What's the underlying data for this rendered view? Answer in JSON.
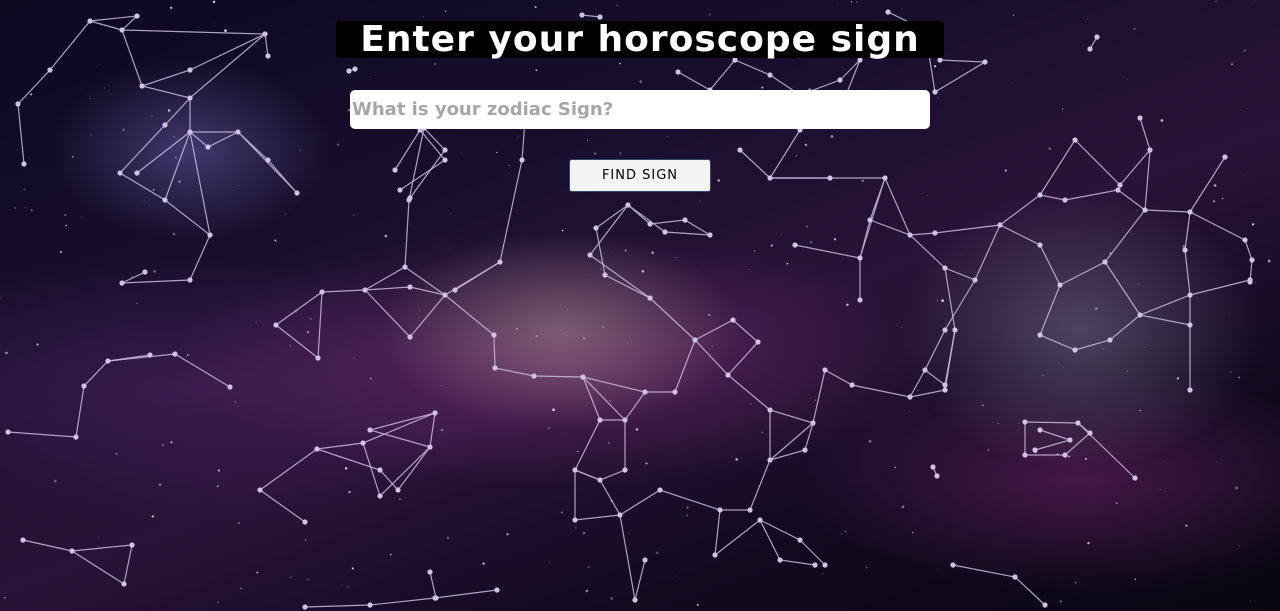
{
  "header": {
    "title": "Enter your horoscope sign"
  },
  "search": {
    "placeholder": "What is your zodiac Sign?",
    "value": ""
  },
  "actions": {
    "find_label": "FIND SIGN"
  },
  "theme": {
    "line_color": "#c9bde0",
    "node_color": "#cfc3e6",
    "button_border": "#2b4a6f"
  }
}
